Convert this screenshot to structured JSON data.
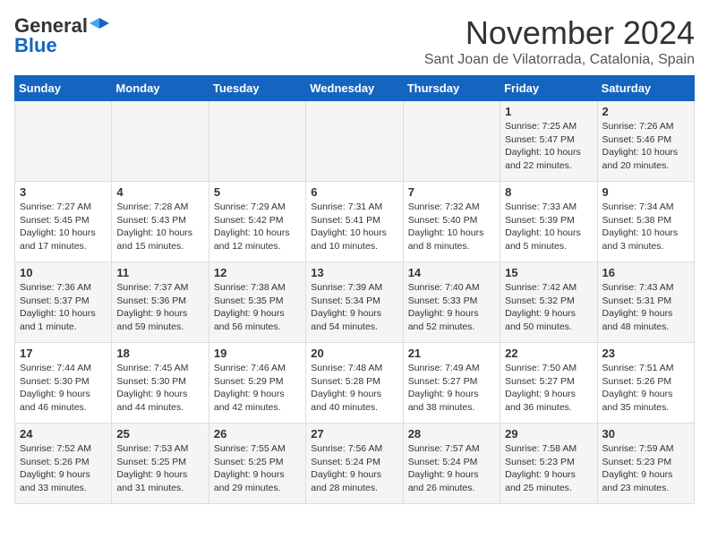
{
  "logo": {
    "general": "General",
    "blue": "Blue"
  },
  "title": "November 2024",
  "location": "Sant Joan de Vilatorrada, Catalonia, Spain",
  "days_of_week": [
    "Sunday",
    "Monday",
    "Tuesday",
    "Wednesday",
    "Thursday",
    "Friday",
    "Saturday"
  ],
  "weeks": [
    [
      {
        "day": "",
        "text": ""
      },
      {
        "day": "",
        "text": ""
      },
      {
        "day": "",
        "text": ""
      },
      {
        "day": "",
        "text": ""
      },
      {
        "day": "",
        "text": ""
      },
      {
        "day": "1",
        "text": "Sunrise: 7:25 AM\nSunset: 5:47 PM\nDaylight: 10 hours and 22 minutes."
      },
      {
        "day": "2",
        "text": "Sunrise: 7:26 AM\nSunset: 5:46 PM\nDaylight: 10 hours and 20 minutes."
      }
    ],
    [
      {
        "day": "3",
        "text": "Sunrise: 7:27 AM\nSunset: 5:45 PM\nDaylight: 10 hours and 17 minutes."
      },
      {
        "day": "4",
        "text": "Sunrise: 7:28 AM\nSunset: 5:43 PM\nDaylight: 10 hours and 15 minutes."
      },
      {
        "day": "5",
        "text": "Sunrise: 7:29 AM\nSunset: 5:42 PM\nDaylight: 10 hours and 12 minutes."
      },
      {
        "day": "6",
        "text": "Sunrise: 7:31 AM\nSunset: 5:41 PM\nDaylight: 10 hours and 10 minutes."
      },
      {
        "day": "7",
        "text": "Sunrise: 7:32 AM\nSunset: 5:40 PM\nDaylight: 10 hours and 8 minutes."
      },
      {
        "day": "8",
        "text": "Sunrise: 7:33 AM\nSunset: 5:39 PM\nDaylight: 10 hours and 5 minutes."
      },
      {
        "day": "9",
        "text": "Sunrise: 7:34 AM\nSunset: 5:38 PM\nDaylight: 10 hours and 3 minutes."
      }
    ],
    [
      {
        "day": "10",
        "text": "Sunrise: 7:36 AM\nSunset: 5:37 PM\nDaylight: 10 hours and 1 minute."
      },
      {
        "day": "11",
        "text": "Sunrise: 7:37 AM\nSunset: 5:36 PM\nDaylight: 9 hours and 59 minutes."
      },
      {
        "day": "12",
        "text": "Sunrise: 7:38 AM\nSunset: 5:35 PM\nDaylight: 9 hours and 56 minutes."
      },
      {
        "day": "13",
        "text": "Sunrise: 7:39 AM\nSunset: 5:34 PM\nDaylight: 9 hours and 54 minutes."
      },
      {
        "day": "14",
        "text": "Sunrise: 7:40 AM\nSunset: 5:33 PM\nDaylight: 9 hours and 52 minutes."
      },
      {
        "day": "15",
        "text": "Sunrise: 7:42 AM\nSunset: 5:32 PM\nDaylight: 9 hours and 50 minutes."
      },
      {
        "day": "16",
        "text": "Sunrise: 7:43 AM\nSunset: 5:31 PM\nDaylight: 9 hours and 48 minutes."
      }
    ],
    [
      {
        "day": "17",
        "text": "Sunrise: 7:44 AM\nSunset: 5:30 PM\nDaylight: 9 hours and 46 minutes."
      },
      {
        "day": "18",
        "text": "Sunrise: 7:45 AM\nSunset: 5:30 PM\nDaylight: 9 hours and 44 minutes."
      },
      {
        "day": "19",
        "text": "Sunrise: 7:46 AM\nSunset: 5:29 PM\nDaylight: 9 hours and 42 minutes."
      },
      {
        "day": "20",
        "text": "Sunrise: 7:48 AM\nSunset: 5:28 PM\nDaylight: 9 hours and 40 minutes."
      },
      {
        "day": "21",
        "text": "Sunrise: 7:49 AM\nSunset: 5:27 PM\nDaylight: 9 hours and 38 minutes."
      },
      {
        "day": "22",
        "text": "Sunrise: 7:50 AM\nSunset: 5:27 PM\nDaylight: 9 hours and 36 minutes."
      },
      {
        "day": "23",
        "text": "Sunrise: 7:51 AM\nSunset: 5:26 PM\nDaylight: 9 hours and 35 minutes."
      }
    ],
    [
      {
        "day": "24",
        "text": "Sunrise: 7:52 AM\nSunset: 5:26 PM\nDaylight: 9 hours and 33 minutes."
      },
      {
        "day": "25",
        "text": "Sunrise: 7:53 AM\nSunset: 5:25 PM\nDaylight: 9 hours and 31 minutes."
      },
      {
        "day": "26",
        "text": "Sunrise: 7:55 AM\nSunset: 5:25 PM\nDaylight: 9 hours and 29 minutes."
      },
      {
        "day": "27",
        "text": "Sunrise: 7:56 AM\nSunset: 5:24 PM\nDaylight: 9 hours and 28 minutes."
      },
      {
        "day": "28",
        "text": "Sunrise: 7:57 AM\nSunset: 5:24 PM\nDaylight: 9 hours and 26 minutes."
      },
      {
        "day": "29",
        "text": "Sunrise: 7:58 AM\nSunset: 5:23 PM\nDaylight: 9 hours and 25 minutes."
      },
      {
        "day": "30",
        "text": "Sunrise: 7:59 AM\nSunset: 5:23 PM\nDaylight: 9 hours and 23 minutes."
      }
    ]
  ]
}
